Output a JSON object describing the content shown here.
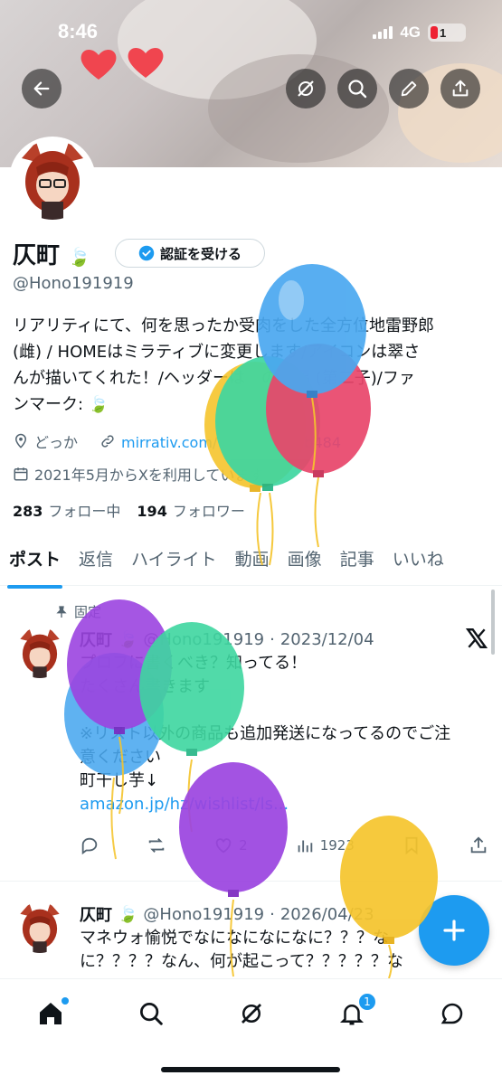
{
  "status_bar": {
    "time": "8:46",
    "network": "4G",
    "battery": "1"
  },
  "profile": {
    "name": "仄町",
    "verify_label": "認証を受ける",
    "handle": "@Hono191919",
    "bio_lines": [
      "リアリティにて、何を思ったか受肉をした全方位地雷野郎",
      "(雌) / HOMEはミラティブに変更します/アイコンは翠さ",
      "んが描いてくれた！/ヘッダーは　の大福 (第二子)/ファ",
      "ンマーク: 🍃"
    ],
    "location": "どっか",
    "website": "mirrativ.com/　　　　　　b484",
    "joined": "2021年5月からXを利用しています",
    "following_count": "283",
    "following_label": "フォロー中",
    "followers_count": "194",
    "followers_label": "フォロワー"
  },
  "tabs": [
    "ポスト",
    "返信",
    "ハイライト",
    "動画",
    "画像",
    "記事",
    "いいね"
  ],
  "pinned_post": {
    "pinned_label": "固定",
    "name": "仄町",
    "handle": "@Hono191919",
    "date": "2023/12/04",
    "lines": [
      "プロフに書くべき？知ってる！",
      "たくさん書きます",
      "",
      "※リスト以外の商品も追加発送になってるのでご注",
      "意ください",
      "町干し芋↓"
    ],
    "link": "amazon.jp/hz/wishlist/ls...",
    "likes": "2",
    "views": "1923"
  },
  "second_post": {
    "name": "仄町",
    "handle": "@Hono191919",
    "date": "2026/04/23",
    "lines": [
      "マネウォ愉悦でなになになになに？？？な",
      "に？？？？なん、何が起こって？？？？？な"
    ]
  },
  "bottom_nav": {
    "notification_badge": "1"
  },
  "colors": {
    "accent": "#1d9bf0",
    "balloon_blue": "#4aa8f0",
    "balloon_green": "#3ed6a0",
    "balloon_red": "#e8456a",
    "balloon_yellow": "#f5c42c",
    "balloon_purple": "#9b44e0"
  }
}
